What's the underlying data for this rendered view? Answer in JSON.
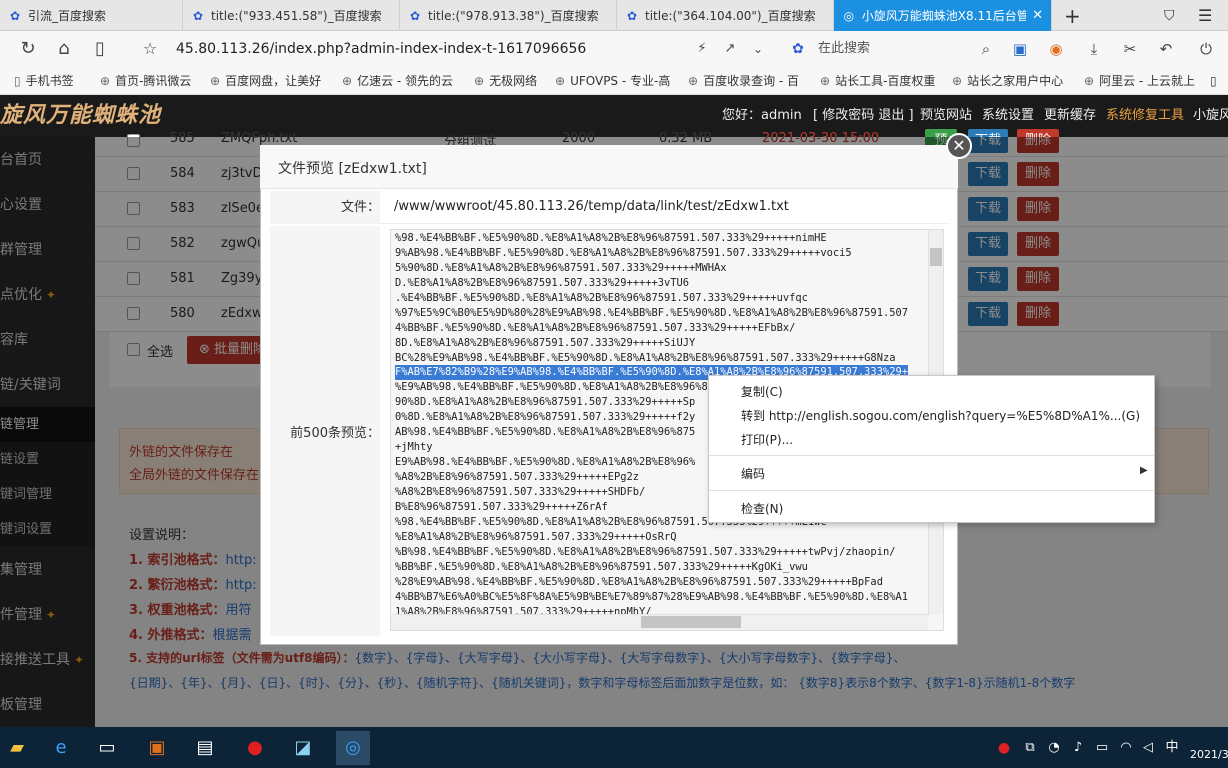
{
  "browser": {
    "tabs": [
      {
        "label": "引流_百度搜索",
        "icon": "paw-icon"
      },
      {
        "label": "title:(\"933.451.58\")_百度搜索",
        "icon": "paw-icon"
      },
      {
        "label": "title:(\"978.913.38\")_百度搜索",
        "icon": "paw-icon"
      },
      {
        "label": "title:(\"364.104.00\")_百度搜索",
        "icon": "paw-icon"
      },
      {
        "label": "小旋风万能蜘蛛池X8.11后台管",
        "icon": "globe-icon"
      }
    ],
    "url": "45.80.113.26/index.php?admin-index-index-t-1617096656",
    "search_placeholder": "在此搜索",
    "bookmarks": [
      "手机书签",
      "首页-腾讯微云",
      "百度网盘，让美好",
      "亿速云 - 领先的云",
      "无极网络",
      "UFOVPS - 专业-高",
      "百度收录查询 - 百",
      "站长工具-百度权重",
      "站长之家用户中心",
      "阿里云 - 上云就上"
    ]
  },
  "app": {
    "logo": "旋风万能蜘蛛池",
    "header": {
      "greeting": "您好：admin",
      "links": "[ 修改密码 退出 ]",
      "preview": "预览网站",
      "settings": "系统设置",
      "cache": "更新缓存",
      "repair": "系统修复工具",
      "more": "小旋风"
    },
    "sidebar": [
      "台首页",
      "心设置",
      "群管理",
      "点优化",
      "容库",
      "链/关键词",
      "链管理",
      "链设置",
      "键词管理",
      "键词设置",
      "集管理",
      "件管理",
      "接推送工具",
      "板管理"
    ]
  },
  "table": {
    "rows": [
      {
        "id": "585",
        "name": "ZMQFph.txt",
        "group": "分组测试",
        "count": "2000",
        "size": "0.32 MB",
        "date": "2021-03-30 15:00"
      },
      {
        "id": "584",
        "name": "zj3tvD"
      },
      {
        "id": "583",
        "name": "zlSe0e"
      },
      {
        "id": "582",
        "name": "zgwQu"
      },
      {
        "id": "581",
        "name": "Zg39y"
      },
      {
        "id": "580",
        "name": "zEdxw"
      }
    ],
    "download_label": "下载",
    "delete_label": "删除",
    "enable_label": "预",
    "select_all": "全选",
    "batch_delete": "批量删除"
  },
  "notice": {
    "line1": "外链的文件保存在",
    "line2": "全局外链的文件保存在"
  },
  "help": {
    "title": "设置说明：",
    "items": [
      {
        "label": "1. 索引池格式：",
        "value": "http:"
      },
      {
        "label": "2. 繁衍池格式：",
        "value": "http:"
      },
      {
        "label": "3. 权重池格式：",
        "value": "用符"
      },
      {
        "label": "4. 外推格式：",
        "value": "根据需"
      },
      {
        "label": "5. 支持的url标签（文件需为utf8编码）：",
        "value": "{数字}、{字母}、{大写字母}、{大小写字母}、{大写字母数字}、{大小写字母数字}、{数字字母}、"
      }
    ],
    "line6": "{日期}、{年}、{月}、{日}、{时}、{分}、{秒}、{随机字符}、{随机关键词}，数字和字母标签后面加数字是位数，如： {数字8}表示8个数字、{数字1-8}示随机1-8个数字"
  },
  "modal": {
    "title": "文件预览 [zEdxw1.txt]",
    "file_label": "文件：",
    "file_path": "/www/wwwroot/45.80.113.26/temp/data/link/test/zEdxw1.txt",
    "preview_label": "前500条预览：",
    "lines": [
      "%98.%E4%BB%BF.%E5%90%8D.%E8%A1%A8%2B%E8%96%87591.507.333%29+++++nimHE",
      "9%AB%98.%E4%BB%BF.%E5%90%8D.%E8%A1%A8%2B%E8%96%87591.507.333%29+++++voci5",
      "5%90%8D.%E8%A1%A8%2B%E8%96%87591.507.333%29+++++MWHAx",
      "D.%E8%A1%A8%2B%E8%96%87591.507.333%29+++++3vTU6",
      ".%E4%BB%BF.%E5%90%8D.%E8%A1%A8%2B%E8%96%87591.507.333%29+++++uvfqc",
      "%97%E5%9C%B0%E5%9D%80%28%E9%AB%98.%E4%BB%BF.%E5%90%8D.%E8%A1%A8%2B%E8%96%87591.507",
      "4%BB%BF.%E5%90%8D.%E8%A1%A8%2B%E8%96%87591.507.333%29+++++EFbBx/",
      "8D.%E8%A1%A8%2B%E8%96%87591.507.333%29+++++SiUJY",
      "BC%28%E9%AB%98.%E4%BB%BF.%E5%90%8D.%E8%A1%A8%2B%E8%96%87591.507.333%29+++++G8Nza",
      "F%AB%E7%82%B9%28%E9%AB%98.%E4%BB%BF.%E5%90%8D.%E8%A1%A8%2B%E8%96%87591.507.333%29+",
      "%E9%AB%98.%E4%BB%BF.%E5%90%8D.%E8%A1%A8%2B%E8%96%8",
      "90%8D.%E8%A1%A8%2B%E8%96%87591.507.333%29+++++Sp",
      "0%8D.%E8%A1%A8%2B%E8%96%87591.507.333%29+++++f2y",
      "AB%98.%E4%BB%BF.%E5%90%8D.%E8%A1%A8%2B%E8%96%875",
      "+jMhty",
      "E9%AB%98.%E4%BB%BF.%E5%90%8D.%E8%A1%A8%2B%E8%96%",
      "%A8%2B%E8%96%87591.507.333%29+++++EPg2z",
      "%A8%2B%E8%96%87591.507.333%29+++++SHDFb/",
      "B%E8%96%87591.507.333%29+++++Z6rAf",
      "%98.%E4%BB%BF.%E5%90%8D.%E8%A1%A8%2B%E8%96%87591.507.333%29+++++mL1wc",
      "%E8%A1%A8%2B%E8%96%87591.507.333%29+++++OsRrQ",
      "%B%98.%E4%BB%BF.%E5%90%8D.%E8%A1%A8%2B%E8%96%87591.507.333%29+++++twPvj/zhaopin/",
      "%BB%BF.%E5%90%8D.%E8%A1%A8%2B%E8%96%87591.507.333%29+++++KgOKi_vwu",
      "%28%E9%AB%98.%E4%BB%BF.%E5%90%8D.%E8%A1%A8%2B%E8%96%87591.507.333%29+++++BpFad",
      "4%BB%B7%E6%A0%BC%E5%8F%8A%E5%9B%BE%E7%89%87%28%E9%AB%98.%E4%BB%BF.%E5%90%8D.%E8%A1",
      "1%A8%2B%E8%96%87591.507.333%29+++++npMhY/"
    ]
  },
  "context_menu": {
    "copy": "复制(C)",
    "goto": "转到 http://english.sogou.com/english?query=%E5%8D%A1%...(G)",
    "print": "打印(P)...",
    "encoding": "编码",
    "inspect": "检查(N)"
  },
  "taskbar": {
    "ime": "中",
    "date": "2021/3"
  },
  "colors": {
    "tab_active": "#1b8fe0",
    "header_bg": "#1a1a1a",
    "sidebar_bg": "#2b2b2b",
    "download": "#2a7db8",
    "delete": "#c0392b",
    "taskbar": "#0d2438"
  }
}
